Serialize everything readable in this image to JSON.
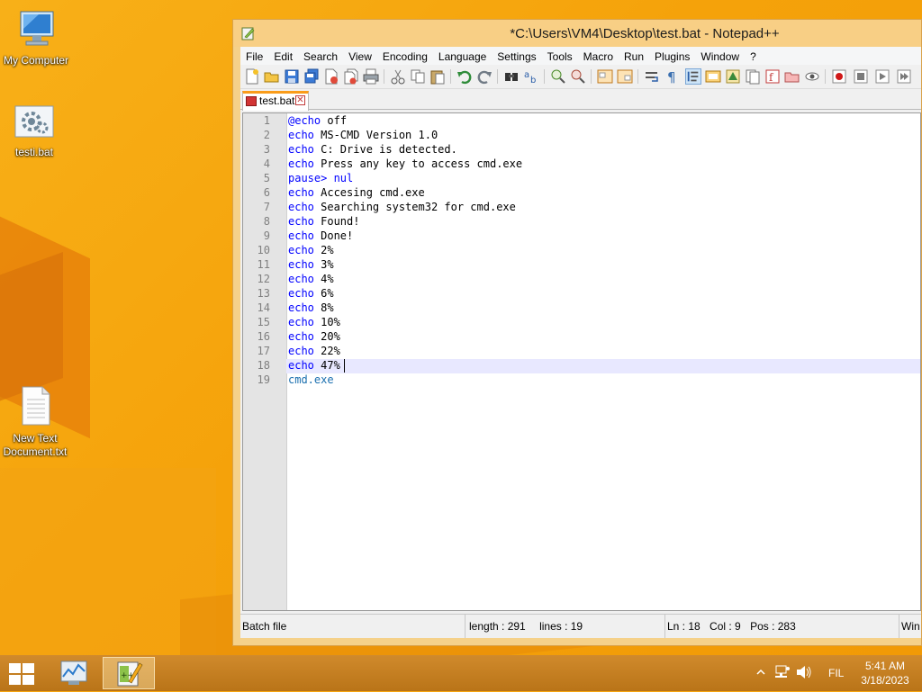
{
  "desktop": {
    "icons": [
      {
        "label": "My Computer"
      },
      {
        "label": "testi.bat"
      },
      {
        "label": "New Text Document.txt"
      }
    ]
  },
  "window": {
    "title": "*C:\\Users\\VM4\\Desktop\\test.bat - Notepad++",
    "menu": [
      "File",
      "Edit",
      "Search",
      "View",
      "Encoding",
      "Language",
      "Settings",
      "Tools",
      "Macro",
      "Run",
      "Plugins",
      "Window",
      "?"
    ],
    "tab": {
      "label": "test.bat",
      "close": "✕"
    },
    "lines": [
      {
        "n": "1",
        "a": "@",
        "k": "echo",
        "r": " off"
      },
      {
        "n": "2",
        "k": "echo",
        "r": " MS-CMD Version 1.0"
      },
      {
        "n": "3",
        "k": "echo",
        "r": " C: Drive is detected."
      },
      {
        "n": "4",
        "k": "echo",
        "r": " Press any key to access cmd.exe"
      },
      {
        "n": "5",
        "k": "pause",
        "r": "> nul"
      },
      {
        "n": "6",
        "k": "echo",
        "r": " Accesing cmd.exe"
      },
      {
        "n": "7",
        "k": "echo",
        "r": " Searching system32 for cmd.exe"
      },
      {
        "n": "8",
        "k": "echo",
        "r": " Found!"
      },
      {
        "n": "9",
        "k": "echo",
        "r": " Done!"
      },
      {
        "n": "10",
        "k": "echo",
        "r": " 2%"
      },
      {
        "n": "11",
        "k": "echo",
        "r": " 3%"
      },
      {
        "n": "12",
        "k": "echo",
        "r": " 4%"
      },
      {
        "n": "13",
        "k": "echo",
        "r": " 6%"
      },
      {
        "n": "14",
        "k": "echo",
        "r": " 8%"
      },
      {
        "n": "15",
        "k": "echo",
        "r": " 10%"
      },
      {
        "n": "16",
        "k": "echo",
        "r": " 20%"
      },
      {
        "n": "17",
        "k": "echo",
        "r": " 22%"
      },
      {
        "n": "18",
        "k": "echo",
        "r": " 47%"
      },
      {
        "n": "19",
        "x": "cmd.exe"
      }
    ],
    "status": {
      "type": "Batch file",
      "length": "length : 291",
      "lines": "lines : 19",
      "ln": "Ln : 18",
      "col": "Col : 9",
      "pos": "Pos : 283",
      "eol": "Win"
    }
  },
  "taskbar": {
    "lang": "FIL",
    "time": "5:41 AM",
    "date": "3/18/2023"
  }
}
